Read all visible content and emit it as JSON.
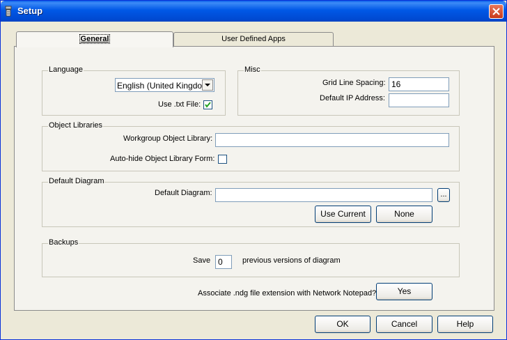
{
  "window": {
    "title": "Setup"
  },
  "tabs": [
    {
      "label": "General"
    },
    {
      "label": "User Defined Apps"
    }
  ],
  "language": {
    "group_label": "Language",
    "selected": "English (United Kingdom)",
    "use_txt_label": "Use .txt File:",
    "use_txt_checked": true
  },
  "misc": {
    "group_label": "Misc",
    "grid_label": "Grid Line Spacing:",
    "grid_value": "16",
    "ip_label": "Default IP Address:",
    "ip_value": ""
  },
  "object_libraries": {
    "group_label": "Object Libraries",
    "workgroup_label": "Workgroup Object Library:",
    "workgroup_value": "",
    "autohide_label": "Auto-hide Object Library Form:",
    "autohide_checked": false
  },
  "default_diagram": {
    "group_label": "Default Diagram",
    "diagram_label": "Default Diagram:",
    "diagram_value": "",
    "browse_label": "...",
    "use_current_label": "Use Current",
    "none_label": "None"
  },
  "backups": {
    "group_label": "Backups",
    "save_label": "Save",
    "save_value": "0",
    "suffix_label": "previous versions of diagram"
  },
  "associate": {
    "label": "Associate .ndg file extension with Network Notepad?",
    "button_label": "Yes"
  },
  "footer": {
    "ok_label": "OK",
    "cancel_label": "Cancel",
    "help_label": "Help"
  }
}
